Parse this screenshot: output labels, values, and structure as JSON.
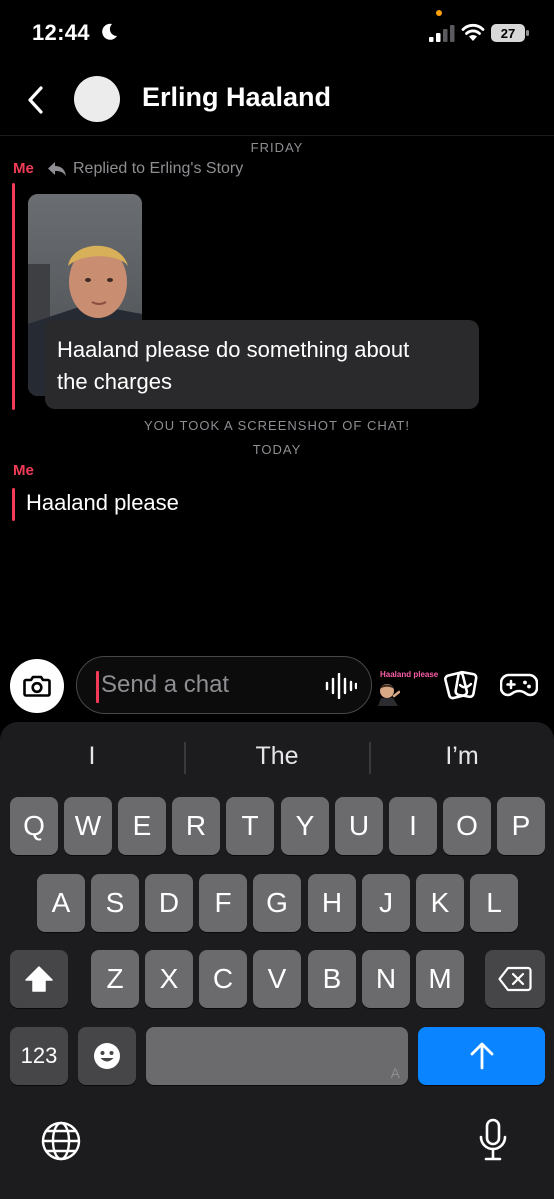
{
  "status_bar": {
    "time": "12:44",
    "battery": "27"
  },
  "header": {
    "contact_name": "Erling Haaland"
  },
  "chat": {
    "friday_label": "FRIDAY",
    "me_label_1": "Me",
    "replied_text": "Replied to Erling's Story",
    "bubble_line_1": "Haaland please do something about",
    "bubble_line_2": "the charges",
    "screenshot_note": "YOU TOOK A SCREENSHOT OF CHAT!",
    "today_label": "TODAY",
    "me_label_2": "Me",
    "message_text": "Haaland please"
  },
  "input": {
    "placeholder": "Send a chat",
    "sticker_text": "Haaland please"
  },
  "keyboard": {
    "suggestions": [
      "I",
      "The",
      "I’m"
    ],
    "row1": [
      "Q",
      "W",
      "E",
      "R",
      "T",
      "Y",
      "U",
      "I",
      "O",
      "P"
    ],
    "row2": [
      "A",
      "S",
      "D",
      "F",
      "G",
      "H",
      "J",
      "K",
      "L"
    ],
    "row3": [
      "Z",
      "X",
      "C",
      "V",
      "B",
      "N",
      "M"
    ],
    "numbers_key": "123",
    "space_hint": "A"
  },
  "colors": {
    "accent": "#f23c57",
    "return_key": "#0a84ff"
  }
}
